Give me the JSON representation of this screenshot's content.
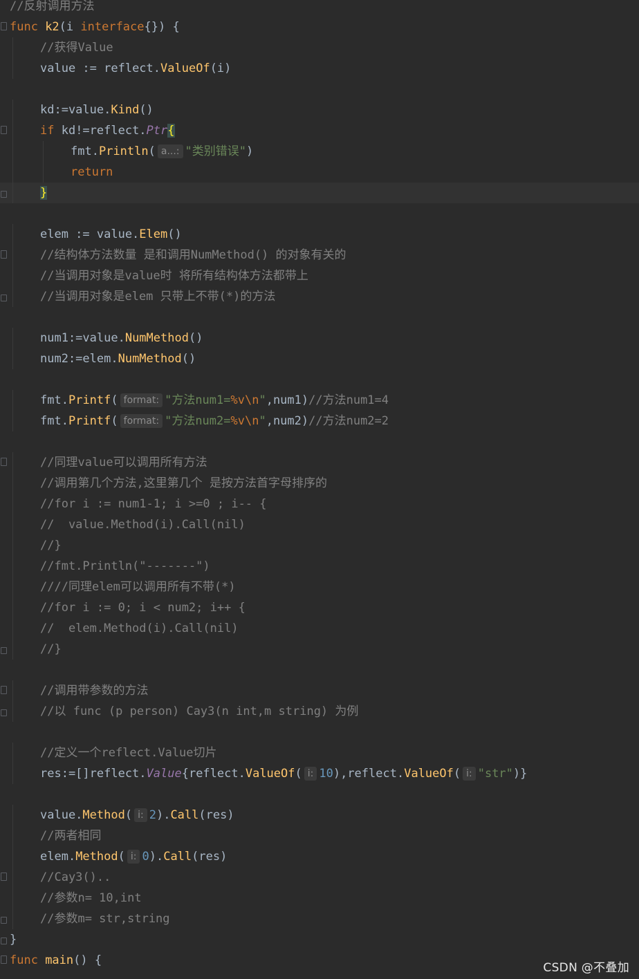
{
  "editor": {
    "lines": [
      {
        "fold": "",
        "tokens": [
          {
            "t": "//反射调用方法",
            "c": "cm"
          }
        ]
      },
      {
        "fold": "start",
        "tokens": [
          {
            "t": "func ",
            "c": "kw"
          },
          {
            "t": "k2",
            "c": "fn"
          },
          {
            "t": "(i ",
            "c": "br"
          },
          {
            "t": "interface",
            "c": "kw"
          },
          {
            "t": "{}) {",
            "c": "br"
          }
        ]
      },
      {
        "fold": "",
        "indent": 1,
        "tokens": [
          {
            "t": "//获得Value",
            "c": "cm"
          }
        ]
      },
      {
        "fold": "",
        "indent": 1,
        "tokens": [
          {
            "t": "value := ",
            "c": "br"
          },
          {
            "t": "reflect",
            "c": "pk"
          },
          {
            "t": ".",
            "c": "br"
          },
          {
            "t": "ValueOf",
            "c": "mt"
          },
          {
            "t": "(i)",
            "c": "br"
          }
        ]
      },
      {
        "fold": "",
        "tokens": []
      },
      {
        "fold": "",
        "indent": 1,
        "tokens": [
          {
            "t": "kd:=value.",
            "c": "br"
          },
          {
            "t": "Kind",
            "c": "mt"
          },
          {
            "t": "()",
            "c": "br"
          }
        ]
      },
      {
        "fold": "start",
        "indent": 1,
        "tokens": [
          {
            "t": "if ",
            "c": "kw"
          },
          {
            "t": "kd!=reflect.",
            "c": "br"
          },
          {
            "t": "Ptr",
            "c": "it"
          },
          {
            "t": "{",
            "c": "brm"
          }
        ]
      },
      {
        "fold": "",
        "indent": 2,
        "tokens": [
          {
            "t": "fmt",
            "c": "pk"
          },
          {
            "t": ".",
            "c": "br"
          },
          {
            "t": "Println",
            "c": "mt"
          },
          {
            "t": "(",
            "c": "br"
          },
          {
            "hint": "a...:"
          },
          {
            "t": "\"类别错误\"",
            "c": "st"
          },
          {
            "t": ")",
            "c": "br"
          }
        ]
      },
      {
        "fold": "",
        "indent": 2,
        "tokens": [
          {
            "t": "return",
            "c": "kw"
          }
        ]
      },
      {
        "fold": "end",
        "indent": 1,
        "hl": true,
        "tokens": [
          {
            "t": "}",
            "c": "brm"
          }
        ]
      },
      {
        "fold": "",
        "tokens": []
      },
      {
        "fold": "",
        "indent": 1,
        "tokens": [
          {
            "t": "elem := value.",
            "c": "br"
          },
          {
            "t": "Elem",
            "c": "mt"
          },
          {
            "t": "()",
            "c": "br"
          }
        ]
      },
      {
        "fold": "start",
        "indent": 1,
        "tokens": [
          {
            "t": "//结构体方法数量 是和调用NumMethod() 的对象有关的",
            "c": "cm"
          }
        ]
      },
      {
        "fold": "",
        "indent": 1,
        "tokens": [
          {
            "t": "//当调用对象是value时 将所有结构体方法都带上",
            "c": "cm"
          }
        ]
      },
      {
        "fold": "end",
        "indent": 1,
        "tokens": [
          {
            "t": "//当调用对象是elem 只带上不带(*)的方法",
            "c": "cm"
          }
        ]
      },
      {
        "fold": "",
        "tokens": []
      },
      {
        "fold": "",
        "indent": 1,
        "tokens": [
          {
            "t": "num1:=value.",
            "c": "br"
          },
          {
            "t": "NumMethod",
            "c": "mt"
          },
          {
            "t": "()",
            "c": "br"
          }
        ]
      },
      {
        "fold": "",
        "indent": 1,
        "tokens": [
          {
            "t": "num2:=elem.",
            "c": "br"
          },
          {
            "t": "NumMethod",
            "c": "mt"
          },
          {
            "t": "()",
            "c": "br"
          }
        ]
      },
      {
        "fold": "",
        "tokens": []
      },
      {
        "fold": "",
        "indent": 1,
        "tokens": [
          {
            "t": "fmt",
            "c": "pk"
          },
          {
            "t": ".",
            "c": "br"
          },
          {
            "t": "Printf",
            "c": "mt"
          },
          {
            "t": "(",
            "c": "br"
          },
          {
            "hint": "format:"
          },
          {
            "t": "\"方法num1=",
            "c": "st"
          },
          {
            "t": "%v\\n",
            "c": "kw"
          },
          {
            "t": "\"",
            "c": "st"
          },
          {
            "t": ",num1)",
            "c": "br"
          },
          {
            "t": "//方法num1=4",
            "c": "cm"
          }
        ]
      },
      {
        "fold": "",
        "indent": 1,
        "tokens": [
          {
            "t": "fmt",
            "c": "pk"
          },
          {
            "t": ".",
            "c": "br"
          },
          {
            "t": "Printf",
            "c": "mt"
          },
          {
            "t": "(",
            "c": "br"
          },
          {
            "hint": "format:"
          },
          {
            "t": "\"方法num2=",
            "c": "st"
          },
          {
            "t": "%v\\n",
            "c": "kw"
          },
          {
            "t": "\"",
            "c": "st"
          },
          {
            "t": ",num2)",
            "c": "br"
          },
          {
            "t": "//方法num2=2",
            "c": "cm"
          }
        ]
      },
      {
        "fold": "",
        "tokens": []
      },
      {
        "fold": "start",
        "indent": 1,
        "tokens": [
          {
            "t": "//同理value可以调用所有方法",
            "c": "cm"
          }
        ]
      },
      {
        "fold": "",
        "indent": 1,
        "tokens": [
          {
            "t": "//调用第几个方法,这里第几个 是按方法首字母排序的",
            "c": "cm"
          }
        ]
      },
      {
        "fold": "",
        "indent": 1,
        "tokens": [
          {
            "t": "//for i := num1-1; i >=0 ; i-- {",
            "c": "cm"
          }
        ]
      },
      {
        "fold": "",
        "indent": 1,
        "tokens": [
          {
            "t": "//  value.Method(i).Call(nil)",
            "c": "cm"
          }
        ]
      },
      {
        "fold": "",
        "indent": 1,
        "tokens": [
          {
            "t": "//}",
            "c": "cm"
          }
        ]
      },
      {
        "fold": "",
        "indent": 1,
        "tokens": [
          {
            "t": "//fmt.Println(\"-------\")",
            "c": "cm"
          }
        ]
      },
      {
        "fold": "",
        "indent": 1,
        "tokens": [
          {
            "t": "////同理elem可以调用所有不带(*)",
            "c": "cm"
          }
        ]
      },
      {
        "fold": "",
        "indent": 1,
        "tokens": [
          {
            "t": "//for i := 0; i < num2; i++ {",
            "c": "cm"
          }
        ]
      },
      {
        "fold": "",
        "indent": 1,
        "tokens": [
          {
            "t": "//  elem.Method(i).Call(nil)",
            "c": "cm"
          }
        ]
      },
      {
        "fold": "end",
        "indent": 1,
        "tokens": [
          {
            "t": "//}",
            "c": "cm"
          }
        ]
      },
      {
        "fold": "",
        "tokens": []
      },
      {
        "fold": "start",
        "indent": 1,
        "tokens": [
          {
            "t": "//调用带参数的方法",
            "c": "cm"
          }
        ]
      },
      {
        "fold": "end",
        "indent": 1,
        "tokens": [
          {
            "t": "//以 func (p person) Cay3(n int,m string) 为例",
            "c": "cm"
          }
        ]
      },
      {
        "fold": "",
        "tokens": []
      },
      {
        "fold": "",
        "indent": 1,
        "tokens": [
          {
            "t": "//定义一个reflect.Value切片",
            "c": "cm"
          }
        ]
      },
      {
        "fold": "",
        "indent": 1,
        "tokens": [
          {
            "t": "res:=[]reflect.",
            "c": "br"
          },
          {
            "t": "Value",
            "c": "it"
          },
          {
            "t": "{reflect.",
            "c": "br"
          },
          {
            "t": "ValueOf",
            "c": "mt"
          },
          {
            "t": "(",
            "c": "br"
          },
          {
            "hint": "i:"
          },
          {
            "t": "10",
            "c": "nm"
          },
          {
            "t": "),reflect.",
            "c": "br"
          },
          {
            "t": "ValueOf",
            "c": "mt"
          },
          {
            "t": "(",
            "c": "br"
          },
          {
            "hint": "i:"
          },
          {
            "t": "\"str\"",
            "c": "st"
          },
          {
            "t": ")}",
            "c": "br"
          }
        ]
      },
      {
        "fold": "",
        "tokens": []
      },
      {
        "fold": "",
        "indent": 1,
        "tokens": [
          {
            "t": "value.",
            "c": "br"
          },
          {
            "t": "Method",
            "c": "mt"
          },
          {
            "t": "(",
            "c": "br"
          },
          {
            "hint": "i:"
          },
          {
            "t": "2",
            "c": "nm"
          },
          {
            "t": ").",
            "c": "br"
          },
          {
            "t": "Call",
            "c": "mt"
          },
          {
            "t": "(res)",
            "c": "br"
          }
        ]
      },
      {
        "fold": "",
        "indent": 1,
        "tokens": [
          {
            "t": "//两者相同",
            "c": "cm"
          }
        ]
      },
      {
        "fold": "",
        "indent": 1,
        "tokens": [
          {
            "t": "elem.",
            "c": "br"
          },
          {
            "t": "Method",
            "c": "mt"
          },
          {
            "t": "(",
            "c": "br"
          },
          {
            "hint": "i:"
          },
          {
            "t": "0",
            "c": "nm"
          },
          {
            "t": ").",
            "c": "br"
          },
          {
            "t": "Call",
            "c": "mt"
          },
          {
            "t": "(res)",
            "c": "br"
          }
        ]
      },
      {
        "fold": "start",
        "indent": 1,
        "tokens": [
          {
            "t": "//Cay3()..",
            "c": "cm"
          }
        ]
      },
      {
        "fold": "",
        "indent": 1,
        "tokens": [
          {
            "t": "//参数n= 10,int",
            "c": "cm"
          }
        ]
      },
      {
        "fold": "end",
        "indent": 1,
        "tokens": [
          {
            "t": "//参数m= str,string",
            "c": "cm"
          }
        ]
      },
      {
        "fold": "end",
        "tokens": [
          {
            "t": "}",
            "c": "br"
          }
        ]
      },
      {
        "fold": "start",
        "tokens": [
          {
            "t": "func ",
            "c": "kw"
          },
          {
            "t": "main",
            "c": "fn"
          },
          {
            "t": "() {",
            "c": "br"
          }
        ]
      }
    ]
  },
  "watermark": "CSDN @不叠加",
  "colors": {
    "background": "#2b2b2b",
    "keyword": "#cc7832",
    "function": "#ffc66d",
    "comment": "#808080",
    "string": "#6a8759",
    "number": "#6897bb",
    "type_italic": "#9876aa",
    "default": "#a9b7c6",
    "brace_match": "#ffef28"
  }
}
